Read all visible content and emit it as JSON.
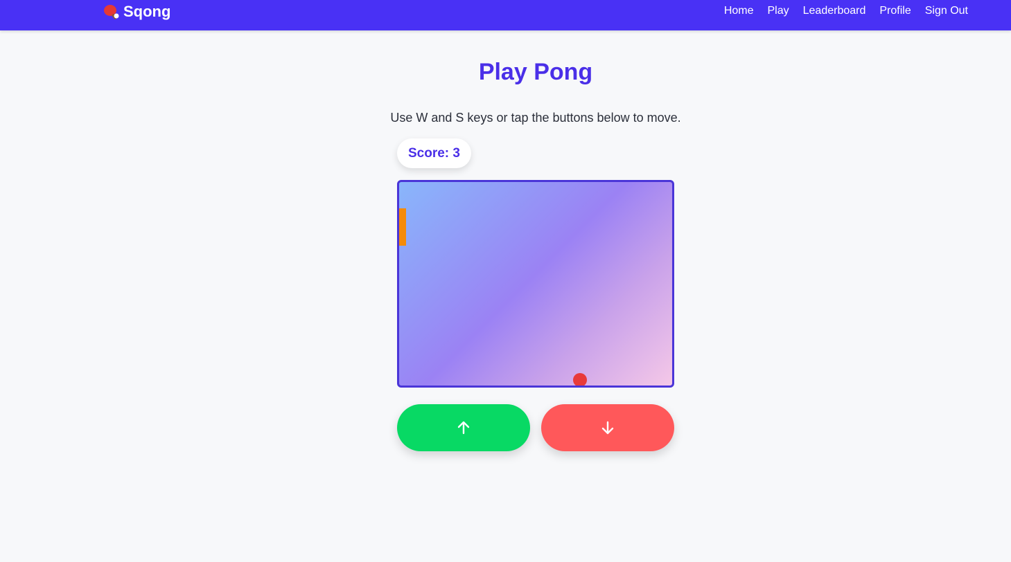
{
  "nav": {
    "brand": "Sqong",
    "links": [
      "Home",
      "Play",
      "Leaderboard",
      "Profile",
      "Sign Out"
    ]
  },
  "page": {
    "title": "Play Pong",
    "instructions": "Use W and S keys or tap the buttons below to move."
  },
  "score": {
    "label": "Score: 3"
  },
  "controls": {
    "up_icon": "arrow-up-icon",
    "down_icon": "arrow-down-icon"
  },
  "colors": {
    "nav_bg": "#4931f5",
    "accent": "#4a2fe8",
    "up_button": "#08d964",
    "down_button": "#ff585a",
    "paddle": "#f58b0a",
    "ball": "#e83a3a"
  }
}
